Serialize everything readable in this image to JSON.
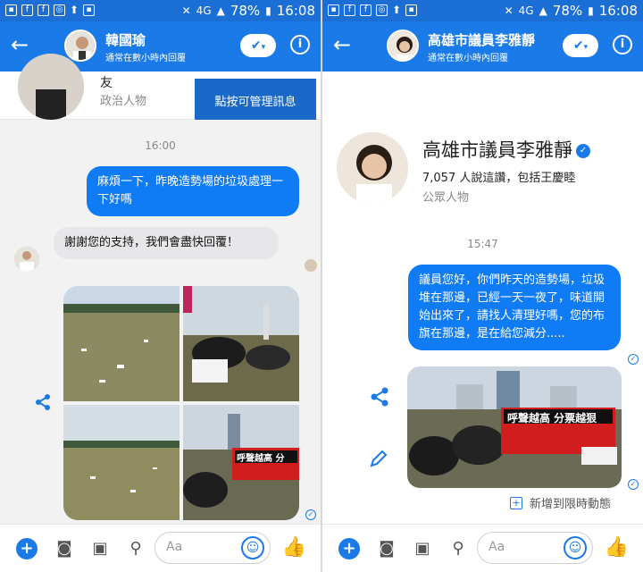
{
  "status": {
    "battery": "78%",
    "time": "16:08",
    "network": "4G"
  },
  "left": {
    "header": {
      "title": "韓國瑜",
      "subtitle": "通常在數小時內回覆"
    },
    "tooltip": "點按可管理訊息",
    "profile": {
      "name_tail": "友",
      "category": "政治人物"
    },
    "timestamp": "16:00",
    "msg_out": "麻煩一下，昨晚造勢場的垃圾處理一下好嗎",
    "msg_in": "謝謝您的支持，我們會盡快回覆！",
    "banner_text": "呼聲越高 分",
    "composer_placeholder": "Aa"
  },
  "right": {
    "header": {
      "title": "高雄市議員李雅靜",
      "subtitle": "通常在數小時內回覆"
    },
    "profile": {
      "name": "高雄市議員李雅靜",
      "likes": "7,057 人說這讚，包括王慶睦",
      "category": "公眾人物"
    },
    "timestamp": "15:47",
    "msg_out": "議員您好，你們昨天的造勢場，垃圾堆在那邊，已經一天一夜了，味道開始出來了，請找人清理好嗎，您的布旗在那邊，是在給您減分.....",
    "banner_text": "呼聲越高 分票越狠",
    "add_story": "新增到限時動態",
    "composer_placeholder": "Aa"
  },
  "colors": {
    "brand": "#1a7ae8",
    "bubble_out": "#0f7bf5",
    "bubble_in": "#e7e7ea"
  },
  "icons": [
    "back-arrow-icon",
    "check-icon",
    "info-icon",
    "share-icon",
    "edit-icon",
    "plus-icon",
    "camera-icon",
    "image-icon",
    "mic-icon",
    "emoji-icon",
    "thumbs-up-icon"
  ]
}
